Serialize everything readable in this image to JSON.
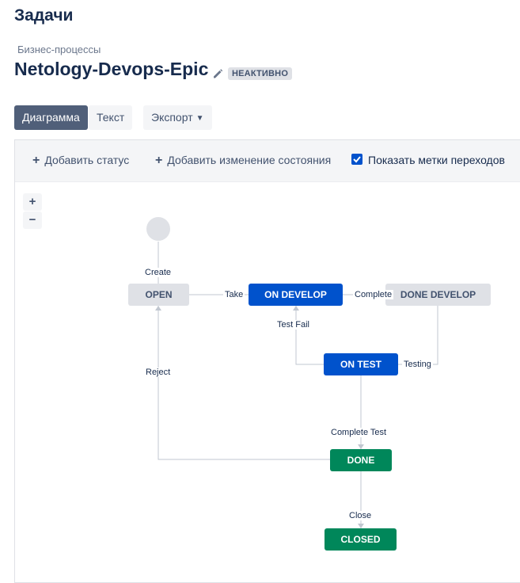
{
  "page": {
    "title": "Задачи"
  },
  "breadcrumb": "Бизнес-процессы",
  "workflow": {
    "name": "Netology-Devops-Epic",
    "status": "НЕАКТИВНО"
  },
  "view_tabs": {
    "diagram": "Диаграмма",
    "text": "Текст",
    "export": "Экспорт"
  },
  "toolbar": {
    "add_status": "Добавить статус",
    "add_transition": "Добавить изменение состояния",
    "show_labels": "Показать метки переходов",
    "show_labels_checked": true
  },
  "zoom": {
    "in": "+",
    "out": "−"
  },
  "statuses": {
    "open": "OPEN",
    "on_develop": "ON DEVELOP",
    "done_develop": "DONE DEVELOP",
    "on_test": "ON TEST",
    "done": "DONE",
    "closed": "CLOSED"
  },
  "transitions": {
    "create": "Create",
    "take": "Take",
    "complete": "Complete",
    "test_fail": "Test Fail",
    "testing": "Testing",
    "reject": "Reject",
    "complete_test": "Complete Test",
    "close": "Close"
  },
  "colors": {
    "status_todo": "#dfe1e6",
    "status_in_progress": "#0052cc",
    "status_done": "#00875a",
    "primary_button": "#505f79"
  }
}
